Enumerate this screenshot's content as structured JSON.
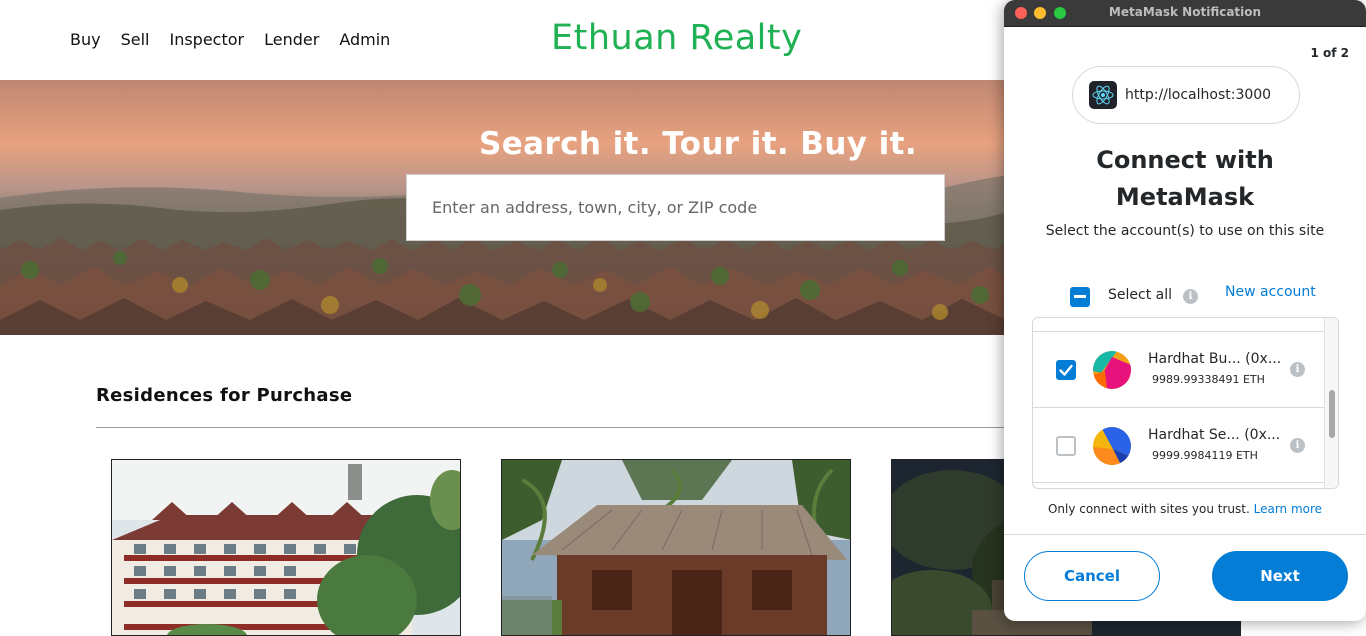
{
  "nav": {
    "links": [
      "Buy",
      "Sell",
      "Inspector",
      "Lender",
      "Admin"
    ],
    "brand": "Ethuan Realty",
    "brand_color": "#1fb153"
  },
  "hero": {
    "title": "Search it. Tour it. Buy it.",
    "search_placeholder": "Enter an address, town, city, or ZIP code",
    "search_value": ""
  },
  "listings": {
    "section_title": "Residences for Purchase",
    "cards": [
      {
        "image": "apartment-building-photo"
      },
      {
        "image": "thatched-hut-photo"
      },
      {
        "image": "night-house-photo"
      }
    ]
  },
  "metamask": {
    "window_title": "MetaMask Notification",
    "page_indicator": "1 of 2",
    "origin": "http://localhost:3000",
    "origin_icon": "react-atom-icon",
    "heading_line1": "Connect with",
    "heading_line2": "MetaMask",
    "subtitle": "Select the account(s) to use on this site",
    "select_all_label": "Select all",
    "select_all_state": "indeterminate",
    "new_account_label": "New account",
    "accounts": [
      {
        "name": "Hardhat Bu... (0x...",
        "balance": "9989.99338491 ETH",
        "checked": true
      },
      {
        "name": "Hardhat Se... (0x...",
        "balance": "9999.9984119 ETH",
        "checked": false
      }
    ],
    "trust_text": "Only connect with sites you trust.",
    "learn_more": "Learn more",
    "cancel_label": "Cancel",
    "next_label": "Next",
    "accent_color": "#037dd6"
  }
}
